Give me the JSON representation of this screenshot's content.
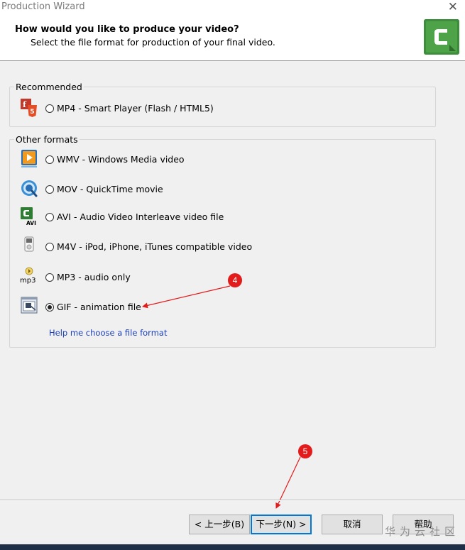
{
  "window": {
    "title": "Production Wizard",
    "close_glyph": "✕"
  },
  "header": {
    "title": "How would you like to produce your video?",
    "subtitle": "Select the file format for production of your final video.",
    "logo_icon": "camtasia-logo-icon",
    "logo_color": "#3d8e3a"
  },
  "recommended": {
    "label": "Recommended",
    "options": [
      {
        "label": "MP4 - Smart Player (Flash / HTML5)",
        "icon": "mp4-flash-html5-icon",
        "checked": false
      }
    ]
  },
  "other": {
    "label": "Other formats",
    "options": [
      {
        "label": "WMV - Windows Media video",
        "icon": "wmv-icon",
        "checked": false
      },
      {
        "label": "MOV - QuickTime movie",
        "icon": "quicktime-icon",
        "checked": false
      },
      {
        "label": "AVI - Audio Video Interleave video file",
        "icon": "avi-icon",
        "icon_text": "AVI",
        "checked": false
      },
      {
        "label": "M4V - iPod, iPhone, iTunes compatible video",
        "icon": "ipod-icon",
        "checked": false
      },
      {
        "label": "MP3 - audio only",
        "icon": "mp3-icon",
        "icon_text": "mp3",
        "checked": false
      },
      {
        "label": "GIF - animation file",
        "icon": "gif-icon",
        "checked": true
      }
    ]
  },
  "help_link": "Help me choose a file format",
  "callouts": [
    "4",
    "5"
  ],
  "buttons": {
    "back": "< 上一步(B)",
    "next": "下一步(N) >",
    "cancel": "取消",
    "help": "帮助"
  },
  "watermark": "华为云社区",
  "annotation_color": "#e31b1b"
}
